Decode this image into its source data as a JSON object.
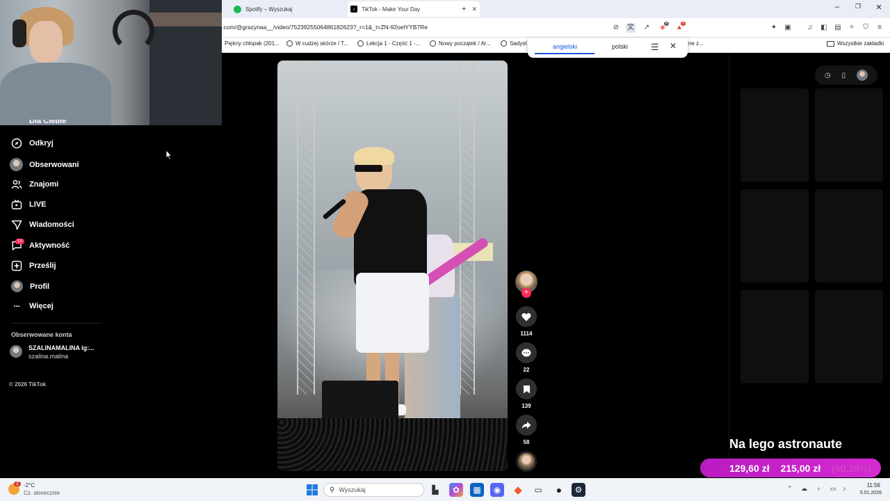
{
  "browser": {
    "tabs": [
      {
        "title": "Spotify – Wyszukaj",
        "icon": "spotify-icon"
      },
      {
        "title": "TikTok - Make Your Day",
        "icon": "tiktok-icon"
      }
    ],
    "new_tab": "+",
    "url": ".com/@grazynaa__/video/7523925506486182623?_r=1&_t=ZN-92oelYYB7Re",
    "bookmarks": [
      "Piękny chłopak (201...",
      "W cudzej skórze / T...",
      "Lekcja 1 - Część 1 -...",
      "Nowy początek / Ar...",
      "Sadyst",
      "ne z..."
    ],
    "all_bookmarks": "Wszystkie zakładki",
    "shield_badge": "8",
    "alert_badge": "1"
  },
  "translate": {
    "lang_from": "angielski",
    "lang_to": "polski"
  },
  "sidebar": {
    "partial_item": "Dla Ciebie",
    "items": [
      {
        "label": "Odkryj",
        "icon": "compass-icon"
      },
      {
        "label": "Obserwowani",
        "icon": "following-avatar"
      },
      {
        "label": "Znajomi",
        "icon": "friends-icon"
      },
      {
        "label": "LIVE",
        "icon": "live-icon"
      },
      {
        "label": "Wiadomości",
        "icon": "messages-icon"
      },
      {
        "label": "Aktywność",
        "icon": "activity-icon"
      },
      {
        "label": "Prześlij",
        "icon": "upload-icon"
      },
      {
        "label": "Profil",
        "icon": "profile-avatar"
      },
      {
        "label": "Więcej",
        "icon": "more-icon"
      }
    ],
    "activity_badge": "13",
    "following_heading": "Obserwowane konta",
    "followed_account": {
      "name": "SZALINAMALINA ig:...",
      "handle": "szalina.malina"
    },
    "footer": "© 2026 TikTok"
  },
  "video_actions": {
    "likes": "1114",
    "comments": "22",
    "saves": "139",
    "shares": "58",
    "follow": "+"
  },
  "promo": {
    "title": "Na lego astronaute",
    "new_price": "129,60 zł",
    "old_price": "215,00 zł",
    "discount": "(60,29%)"
  },
  "taskbar": {
    "weather_temp": "-2°C",
    "weather_desc": "Cz. słonecznie",
    "weather_badge": "2",
    "search_placeholder": "Wyszukaj",
    "time": "11:56",
    "date": "5.01.2026"
  },
  "colors": {
    "accent": "#fe2c55",
    "promo": "#c622c9",
    "link": "#1a56db"
  }
}
